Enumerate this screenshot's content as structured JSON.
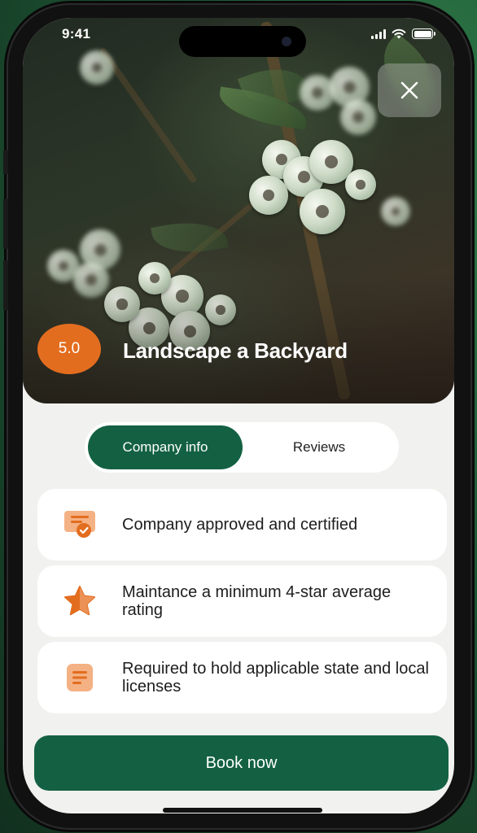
{
  "status_bar": {
    "time": "9:41"
  },
  "hero": {
    "rating": "5.0",
    "title": "Landscape a Backyard"
  },
  "tabs": [
    {
      "label": "Company info",
      "active": true
    },
    {
      "label": "Reviews",
      "active": false
    }
  ],
  "features": [
    {
      "icon": "certificate-icon",
      "text": "Company approved and certified"
    },
    {
      "icon": "star-icon",
      "text": "Maintance a minimum 4-star average rating"
    },
    {
      "icon": "document-icon",
      "text": "Required to hold applicable state and local licenses"
    }
  ],
  "cta": {
    "label": "Book now"
  },
  "colors": {
    "brand_green": "#136142",
    "accent_orange": "#e36d1f",
    "icon_orange_light": "#f4b184",
    "background": "#f1f1ef"
  }
}
